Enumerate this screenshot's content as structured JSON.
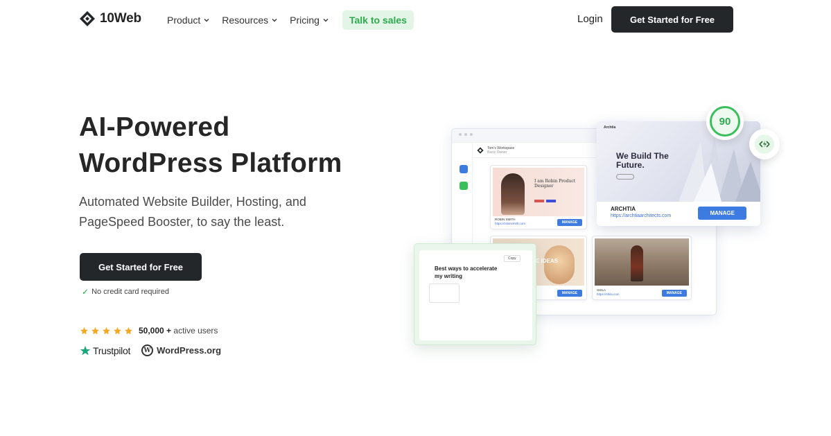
{
  "nav": {
    "brand": "10Web",
    "menu": [
      {
        "label": "Product"
      },
      {
        "label": "Resources"
      },
      {
        "label": "Pricing"
      }
    ],
    "talk_label": "Talk to sales",
    "login_label": "Login",
    "cta_label": "Get Started for Free"
  },
  "hero": {
    "title_line1": "AI-Powered",
    "title_line2": "WordPress Platform",
    "subtitle_line1": "Automated Website Builder, Hosting, and",
    "subtitle_line2": "PageSpeed Booster, to say the least.",
    "cta_label": "Get Started for Free",
    "no_cc": "No credit card required",
    "stars": 5,
    "users_count": "50,000 +",
    "users_suffix": "active users",
    "trustpilot": "Trustpilot",
    "wordpress": "WordPress.org"
  },
  "illustration": {
    "workspace_name": "Tom's Workspace",
    "workspace_role": "Basic Owner",
    "cards": [
      {
        "headline": "I am Robin Product Designer",
        "name": "ROBIN SMITH",
        "url": "https://robinsmith.com",
        "button": "MANAGE"
      },
      {
        "headline": "E IDEAS",
        "name": "",
        "url": "",
        "button": "MANAGE"
      },
      {
        "headline": "",
        "name": "SHILA",
        "url": "https://shila.com",
        "button": "MANAGE"
      }
    ],
    "arch": {
      "brand": "Archtia",
      "headline_line1": "We Build The",
      "headline_line2": "Future.",
      "name": "ARCHTIA",
      "url": "https://archtiaarchitects.com",
      "button": "MANAGE"
    },
    "score": "90",
    "writer": {
      "copy": "Copy",
      "heading": "Best ways to accelerate my writing"
    }
  },
  "colors": {
    "dark": "#232729",
    "green": "#2fa84f",
    "green_bg": "#e3f5e6",
    "star": "#f5a623",
    "blue": "#3d7be0"
  }
}
